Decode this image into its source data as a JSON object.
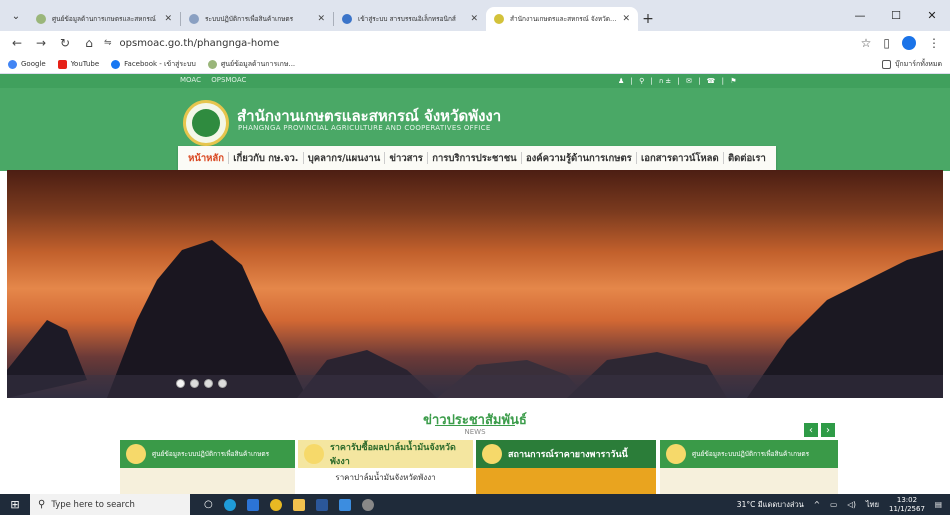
{
  "browser": {
    "tabs": [
      {
        "title": "ศูนย์ข้อมูลด้านการเกษตรและสหกรณ์",
        "color": "#9ab67a"
      },
      {
        "title": "ระบบปฏิบัติการเพื่อสินค้าเกษตร",
        "color": "#8aa0c2"
      },
      {
        "title": "เข้าสู่ระบบ สารบรรณอิเล็กทรอนิกส์",
        "color": "#3b74c9"
      },
      {
        "title": "สำนักงานเกษตรและสหกรณ์ จังหวัดพังงา",
        "color": "#d3c23a"
      }
    ],
    "url": "opsmoac.go.th/phangnga-home",
    "bookmarks": [
      {
        "label": "Google",
        "color": "#4285f4"
      },
      {
        "label": "YouTube",
        "color": "#e62117"
      },
      {
        "label": "Facebook - เข้าสู่ระบบ",
        "color": "#1877f2"
      },
      {
        "label": "ศูนย์ข้อมูลด้านการเกษ...",
        "color": "#9ab67a"
      }
    ],
    "bookmarks_right": "บุ๊กมาร์กทั้งหมด"
  },
  "site": {
    "top_links": [
      "MOAC",
      "OPSMOAC"
    ],
    "title": "สำนักงานเกษตรและสหกรณ์ จังหวัดพังงา",
    "subtitle": "PHANGNGA PROVINCIAL AGRICULTURE AND COOPERATIVES OFFICE",
    "menu": [
      "หน้าหลัก",
      "เกี่ยวกับ กษ.จว.",
      "บุคลากร/แผนงาน",
      "ข่าวสาร",
      "การบริการประชาชน",
      "องค์ความรู้ด้านการเกษตร",
      "เอกสารดาวน์โหลด",
      "ติดต่อเรา"
    ],
    "news_heading": "ข่าวประชาสัมพันธ์",
    "news_sub": "NEWS",
    "cards": [
      {
        "top": "ศูนย์ข้อมูลระบบปฏิบัติการเพื่อสินค้าเกษตร",
        "bottom": ""
      },
      {
        "top": "ราคารับซื้อผลปาล์มน้ำมันจังหวัดพังงา",
        "bottom": "ราคาปาล์มน้ำมันจังหวัดพังงา"
      },
      {
        "top": "สถานการณ์ราคายางพาราวันนี้",
        "bottom": ""
      },
      {
        "top": "ศูนย์ข้อมูลระบบปฏิบัติการเพื่อสินค้าเกษตร",
        "bottom": ""
      }
    ]
  },
  "taskbar": {
    "search_placeholder": "Type here to search",
    "weather": "31°C มีแดดบางส่วน",
    "lang": "ไทย",
    "time": "13:02",
    "date": "11/1/2567"
  }
}
